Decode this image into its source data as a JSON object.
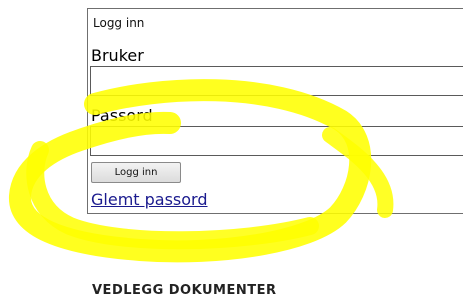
{
  "login": {
    "title": "Logg inn",
    "username_label": "Bruker",
    "username_value": "",
    "password_label": "Passord",
    "password_value": "",
    "submit_label": "Logg inn",
    "forgot_label": "Glemt passord"
  },
  "section": {
    "heading": "VEDLEGG DOKUMENTER"
  },
  "colors": {
    "highlight": "#ffff00",
    "link": "#1a1a8e",
    "border": "#6f6f6f"
  }
}
